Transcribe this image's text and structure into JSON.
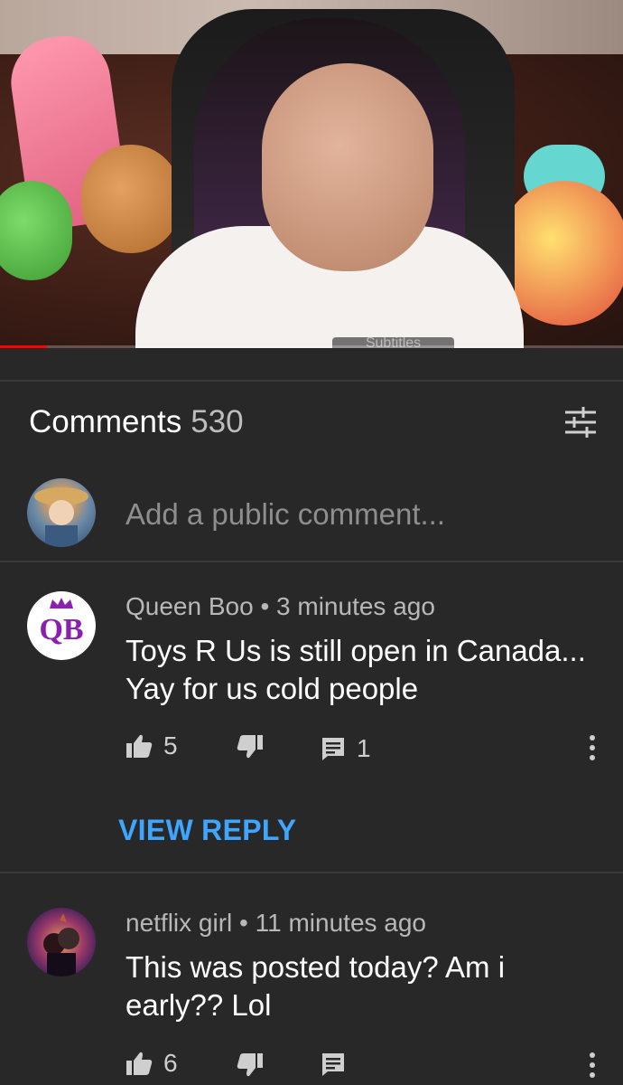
{
  "video": {
    "progress_fraction": 0.075,
    "subtitles_chip": "Subtitles"
  },
  "comments_section": {
    "title": "Comments",
    "count": "530",
    "add_comment_placeholder": "Add a public comment..."
  },
  "comments": [
    {
      "author": "Queen Boo",
      "time": "3 minutes ago",
      "meta": "Queen Boo • 3 minutes ago",
      "text": "Toys R Us is still open in Canada... Yay for us cold people",
      "likes": "5",
      "replies": "1",
      "avatar_text": "QB",
      "view_reply_label": "VIEW REPLY"
    },
    {
      "author": "netflix girl",
      "time": "11 minutes ago",
      "meta": "netflix girl • 11 minutes ago",
      "text": "This was posted today? Am i early?? Lol",
      "likes": "6",
      "replies": ""
    }
  ],
  "colors": {
    "background": "#282828",
    "link": "#3ea6ff",
    "progress": "#ff0000"
  }
}
